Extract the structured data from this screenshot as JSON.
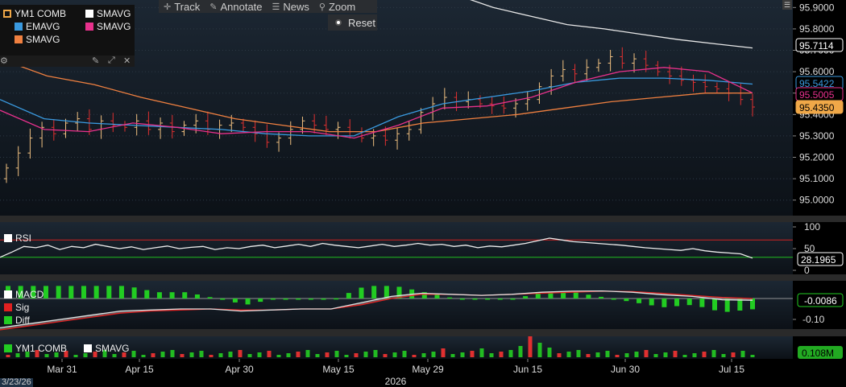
{
  "toolbar": {
    "track": "Track",
    "annotate": "Annotate",
    "news": "News",
    "zoom": "Zoom",
    "reset": "Reset"
  },
  "legend": {
    "items": [
      {
        "label": "YM1 COMB",
        "color": "#f0a848"
      },
      {
        "label": "SMAVG",
        "color": "#ffffff"
      },
      {
        "label": "EMAVG",
        "color": "#3a9ae0"
      },
      {
        "label": "SMAVG",
        "color": "#e8318c"
      },
      {
        "label": "SMAVG",
        "color": "#f08040"
      }
    ]
  },
  "panes": {
    "rsi_label": "RSI",
    "macd_label": "MACD",
    "sig_label": "Sig",
    "diff_label": "Diff",
    "vol_label": "YM1 COMB",
    "vol_smavg_label": "SMAVG"
  },
  "selected_date": "3/23/26",
  "year_label": "2026",
  "chart_data": {
    "type": "candlestick",
    "x_ticks": [
      "Mar 31",
      "Apr 15",
      "Apr 30",
      "May 15",
      "May 29",
      "Jun 15",
      "Jun 30",
      "Jul 15"
    ],
    "price": {
      "ylim": [
        94.95,
        95.92
      ],
      "ticks": [
        "95.9000",
        "95.8000",
        "95.7000",
        "95.6000",
        "95.5000",
        "95.4000",
        "95.3000",
        "95.2000",
        "95.1000",
        "95.0000"
      ],
      "last_labels": [
        {
          "text": "95.7114",
          "color": "#ffffff"
        },
        {
          "text": "95.5422",
          "color": "#3a9ae0"
        },
        {
          "text": "95.5005",
          "color": "#e8318c"
        },
        {
          "text": "95.4350",
          "color": "#f0a848"
        }
      ],
      "closes": [
        95.15,
        95.22,
        95.29,
        95.34,
        95.31,
        95.36,
        95.38,
        95.33,
        95.37,
        95.35,
        95.34,
        95.37,
        95.33,
        95.36,
        95.32,
        95.35,
        95.37,
        95.33,
        95.35,
        95.36,
        95.34,
        95.31,
        95.27,
        95.29,
        95.33,
        95.37,
        95.35,
        95.33,
        95.34,
        95.32,
        95.29,
        95.3,
        95.28,
        95.31,
        95.33,
        95.41,
        95.45,
        95.48,
        95.46,
        95.47,
        95.45,
        95.44,
        95.43,
        95.45,
        95.47,
        95.53,
        95.58,
        95.61,
        95.59,
        95.62,
        95.64,
        95.67,
        95.64,
        95.66,
        95.63,
        95.6,
        95.58,
        95.56,
        95.55,
        95.53,
        95.52,
        95.5,
        95.47,
        95.435
      ],
      "sma_white": [
        96.05,
        95.96,
        95.9,
        95.86,
        95.82,
        95.8,
        95.775,
        95.75,
        95.73,
        95.711
      ],
      "ema_blue": [
        95.47,
        95.38,
        95.36,
        95.35,
        95.34,
        95.33,
        95.31,
        95.3,
        95.3,
        95.39,
        95.45,
        95.48,
        95.51,
        95.55,
        95.57,
        95.57,
        95.56,
        95.542
      ],
      "sma_pink": [
        95.42,
        95.33,
        95.32,
        95.36,
        95.34,
        95.31,
        95.32,
        95.32,
        95.29,
        95.35,
        95.43,
        95.44,
        95.48,
        95.55,
        95.6,
        95.62,
        95.6,
        95.5005
      ],
      "sma_orange": [
        95.66,
        95.58,
        95.54,
        95.48,
        95.43,
        95.38,
        95.35,
        95.32,
        95.32,
        95.36,
        95.38,
        95.4,
        95.43,
        95.46,
        95.48,
        95.5,
        95.5005
      ]
    },
    "rsi": {
      "ylim": [
        0,
        100
      ],
      "ticks": [
        "100",
        "50",
        "0"
      ],
      "overbought": 70,
      "oversold": 30,
      "last": "28.1965",
      "values": [
        30,
        42,
        55,
        52,
        58,
        48,
        55,
        52,
        60,
        55,
        50,
        54,
        48,
        52,
        56,
        50,
        53,
        55,
        48,
        52,
        50,
        55,
        58,
        52,
        56,
        60,
        55,
        62,
        58,
        55,
        52,
        56,
        60,
        55,
        58,
        62,
        58,
        60,
        55,
        58,
        52,
        56,
        54,
        58,
        62,
        68,
        74,
        70,
        66,
        64,
        62,
        60,
        58,
        55,
        52,
        50,
        48,
        46,
        50,
        45,
        42,
        40,
        38,
        28.2
      ]
    },
    "macd": {
      "ticks": [
        "-0.10"
      ],
      "last": "-0.0086",
      "macd": [
        -0.14,
        -0.12,
        -0.1,
        -0.08,
        -0.06,
        -0.055,
        -0.05,
        -0.05,
        -0.06,
        -0.055,
        -0.05,
        -0.05,
        -0.02,
        0.01,
        0.025,
        0.02,
        0.015,
        0.02,
        0.03,
        0.035,
        0.036,
        0.03,
        0.018,
        0.01,
        -0.006,
        -0.0086
      ],
      "sig": [
        -0.15,
        -0.13,
        -0.11,
        -0.09,
        -0.07,
        -0.06,
        -0.055,
        -0.05,
        -0.055,
        -0.055,
        -0.05,
        -0.05,
        -0.03,
        0.0,
        0.02,
        0.02,
        0.015,
        0.02,
        0.025,
        0.03,
        0.035,
        0.033,
        0.025,
        0.015,
        0.005,
        0.0
      ]
    },
    "volume": {
      "last": "0.108M"
    }
  }
}
